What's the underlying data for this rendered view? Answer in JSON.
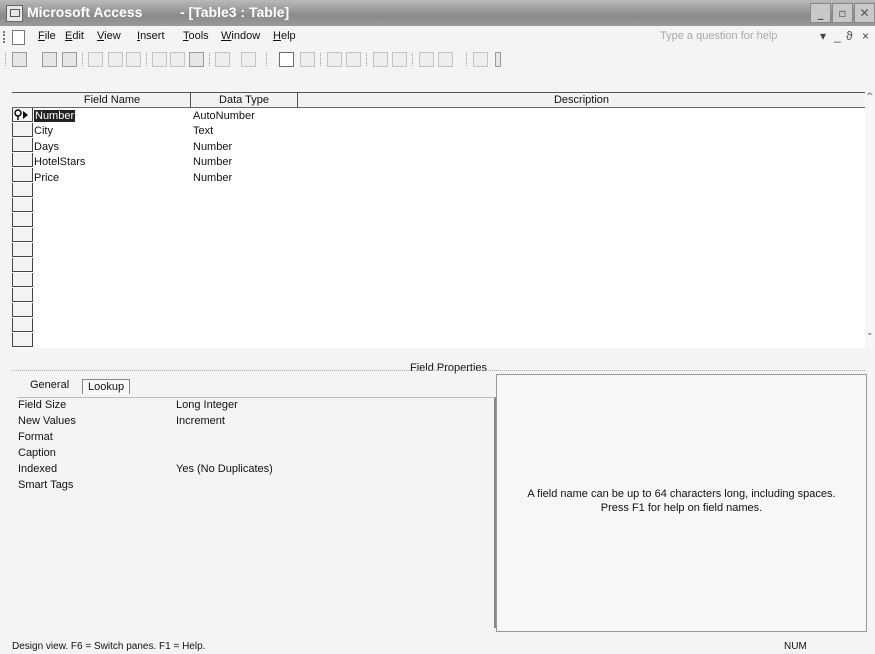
{
  "window": {
    "app_title": "Microsoft Access",
    "doc_title": "- [Table3 : Table]"
  },
  "menubar": {
    "items": [
      "File",
      "Edit",
      "View",
      "Insert",
      "Tools",
      "Window",
      "Help"
    ],
    "help_placeholder": "Type a question for help"
  },
  "grid": {
    "headers": {
      "field_name": "Field Name",
      "data_type": "Data Type",
      "description": "Description"
    },
    "rows": [
      {
        "field": "Number",
        "type": "AutoNumber",
        "primary_key": true,
        "selected": true
      },
      {
        "field": "City",
        "type": "Text"
      },
      {
        "field": "Days",
        "type": "Number"
      },
      {
        "field": "HotelStars",
        "type": "Number"
      },
      {
        "field": "Price",
        "type": "Number"
      }
    ]
  },
  "field_properties": {
    "label": "Field Properties",
    "tabs": [
      "General",
      "Lookup"
    ],
    "active_tab": "General",
    "properties": [
      {
        "name": "Field Size",
        "value": "Long Integer"
      },
      {
        "name": "New Values",
        "value": "Increment"
      },
      {
        "name": "Format",
        "value": ""
      },
      {
        "name": "Caption",
        "value": ""
      },
      {
        "name": "Indexed",
        "value": "Yes (No Duplicates)"
      },
      {
        "name": "Smart Tags",
        "value": ""
      }
    ]
  },
  "help": {
    "line1": "A field name can be up to 64 characters long, including spaces.",
    "line2": "Press F1 for help on field names."
  },
  "status": {
    "left": "Design view.  F6 = Switch panes.  F1 = Help.",
    "num": "NUM"
  }
}
